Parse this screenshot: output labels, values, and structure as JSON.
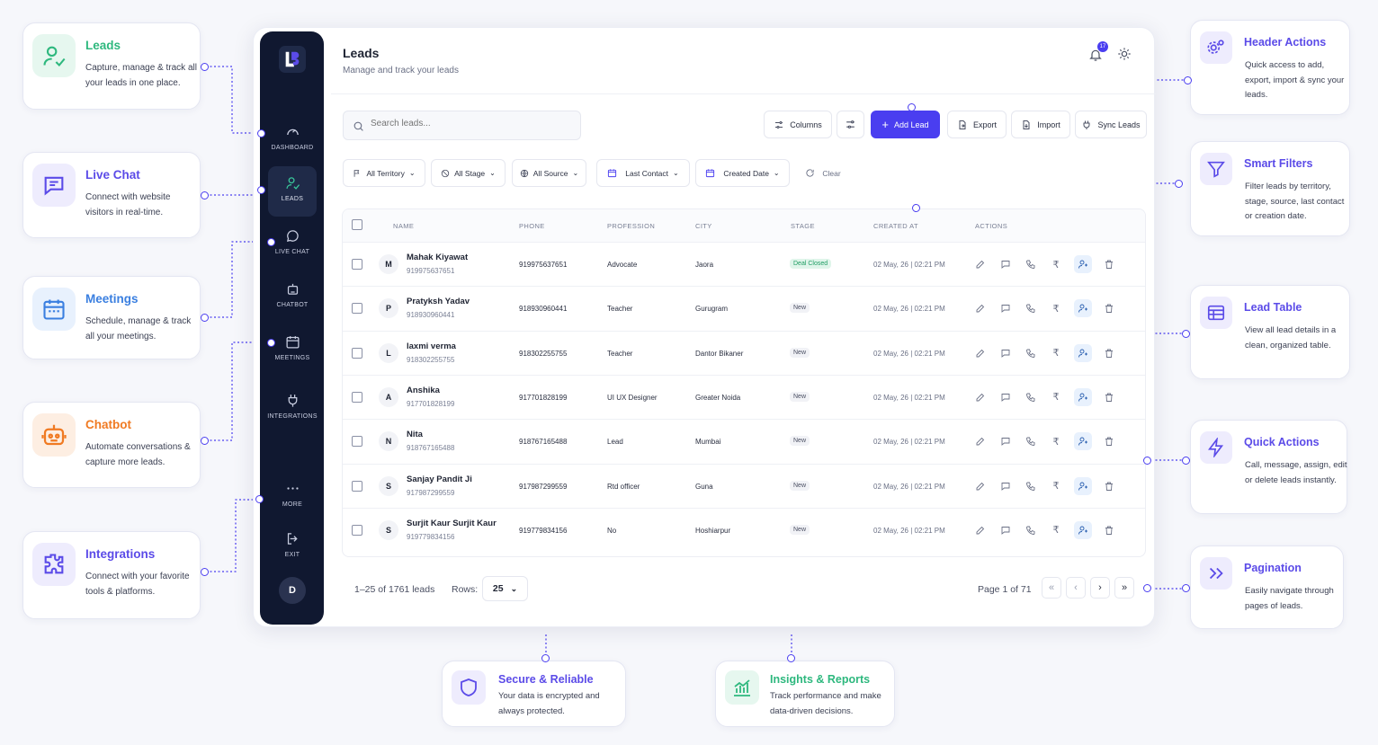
{
  "callouts_left": [
    {
      "title": "Leads",
      "desc": "Capture, manage & track all your leads in one place.",
      "icon": "user-check-icon",
      "color": "#2eb87e"
    },
    {
      "title": "Live Chat",
      "desc": "Connect with website visitors in real-time.",
      "icon": "chat-icon",
      "color": "#5b4be8"
    },
    {
      "title": "Meetings",
      "desc": "Schedule, manage & track all your meetings.",
      "icon": "calendar-icon",
      "color": "#3a7fe0"
    },
    {
      "title": "Chatbot",
      "desc": "Automate conversations & capture more leads.",
      "icon": "robot-icon",
      "color": "#f07a22"
    },
    {
      "title": "Integrations",
      "desc": "Connect with your favorite tools & platforms.",
      "icon": "puzzle-icon",
      "color": "#5b4be8"
    }
  ],
  "callouts_right": [
    {
      "title": "Header Actions",
      "desc": "Quick access to add, export, import & sync your leads.",
      "icon": "gears-icon",
      "color": "#5b4be8"
    },
    {
      "title": "Smart Filters",
      "desc": "Filter leads by territory, stage, source, last contact or creation date.",
      "icon": "filter-icon",
      "color": "#5b4be8"
    },
    {
      "title": "Lead Table",
      "desc": "View all lead details in a clean, organized table.",
      "icon": "table-icon",
      "color": "#5b4be8"
    },
    {
      "title": "Quick Actions",
      "desc": "Call, message, assign, edit or delete leads instantly.",
      "icon": "lightning-icon",
      "color": "#5b4be8"
    },
    {
      "title": "Pagination",
      "desc": "Easily navigate through pages of leads.",
      "icon": "double-chevron-icon",
      "color": "#5b4be8"
    }
  ],
  "callouts_bottom": [
    {
      "title": "Secure & Reliable",
      "desc": "Your data is encrypted and always protected.",
      "icon": "shield-icon",
      "color": "#5b4be8"
    },
    {
      "title": "Insights & Reports",
      "desc": "Track performance and make data-driven decisions.",
      "icon": "chart-icon",
      "color": "#2eb87e"
    }
  ],
  "sidebar": {
    "items": [
      {
        "label": "DASHBOARD",
        "icon": "speedometer-icon"
      },
      {
        "label": "LEADS",
        "icon": "user-check-icon"
      },
      {
        "label": "LIVE CHAT",
        "icon": "chat-icon"
      },
      {
        "label": "CHATBOT",
        "icon": "robot-icon"
      },
      {
        "label": "MEETINGS",
        "icon": "calendar-icon"
      },
      {
        "label": "INTEGRATIONS",
        "icon": "plug-icon"
      },
      {
        "label": "MORE",
        "icon": "dots-icon"
      },
      {
        "label": "EXIT",
        "icon": "exit-icon"
      }
    ],
    "avatar": "D"
  },
  "header": {
    "title": "Leads",
    "subtitle": "Manage and track your leads",
    "notif_count": "17"
  },
  "toolbar": {
    "search_placeholder": "Search leads...",
    "columns": "Columns",
    "add": "Add Lead",
    "export": "Export",
    "import": "Import",
    "sync": "Sync Leads"
  },
  "filters": {
    "territory": "All Territory",
    "stage": "All Stage",
    "source": "All Source",
    "last_contact": "Last Contact",
    "created": "Created Date",
    "clear": "Clear"
  },
  "table": {
    "headers": [
      "NAME",
      "PHONE",
      "PROFESSION",
      "CITY",
      "STAGE",
      "CREATED AT",
      "ACTIONS"
    ],
    "rows": [
      {
        "initial": "M",
        "name": "Mahak Kiyawat",
        "sub": "919975637651",
        "phone": "919975637651",
        "profession": "Advocate",
        "city": "Jaora",
        "stage": "Deal Closed",
        "created": "02 May, 26 | 02:21 PM"
      },
      {
        "initial": "P",
        "name": "Pratyksh Yadav",
        "sub": "918930960441",
        "phone": "918930960441",
        "profession": "Teacher",
        "city": "Gurugram",
        "stage": "New",
        "created": "02 May, 26 | 02:21 PM"
      },
      {
        "initial": "L",
        "name": "laxmi verma",
        "sub": "918302255755",
        "phone": "918302255755",
        "profession": "Teacher",
        "city": "Dantor Bikaner",
        "stage": "New",
        "created": "02 May, 26 | 02:21 PM"
      },
      {
        "initial": "A",
        "name": "Anshika",
        "sub": "917701828199",
        "phone": "917701828199",
        "profession": "UI UX Designer",
        "city": "Greater Noida",
        "stage": "New",
        "created": "02 May, 26 | 02:21 PM"
      },
      {
        "initial": "N",
        "name": "Nita",
        "sub": "918767165488",
        "phone": "918767165488",
        "profession": "Lead",
        "city": "Mumbai",
        "stage": "New",
        "created": "02 May, 26 | 02:21 PM"
      },
      {
        "initial": "S",
        "name": "Sanjay Pandit Ji",
        "sub": "917987299559",
        "phone": "917987299559",
        "profession": "Rtd officer",
        "city": "Guna",
        "stage": "New",
        "created": "02 May, 26 | 02:21 PM"
      },
      {
        "initial": "S",
        "name": "Surjit Kaur Surjit Kaur",
        "sub": "919779834156",
        "phone": "919779834156",
        "profession": "No",
        "city": "Hoshiarpur",
        "stage": "New",
        "created": "02 May, 26 | 02:21 PM"
      }
    ]
  },
  "footer": {
    "range": "1–25 of 1761 leads",
    "rows_label": "Rows:",
    "rows_value": "25",
    "page": "Page 1 of 71"
  },
  "colors": {
    "accent": "#4a3ef0",
    "sidebar": "#101830",
    "green": "#2eb87e"
  }
}
